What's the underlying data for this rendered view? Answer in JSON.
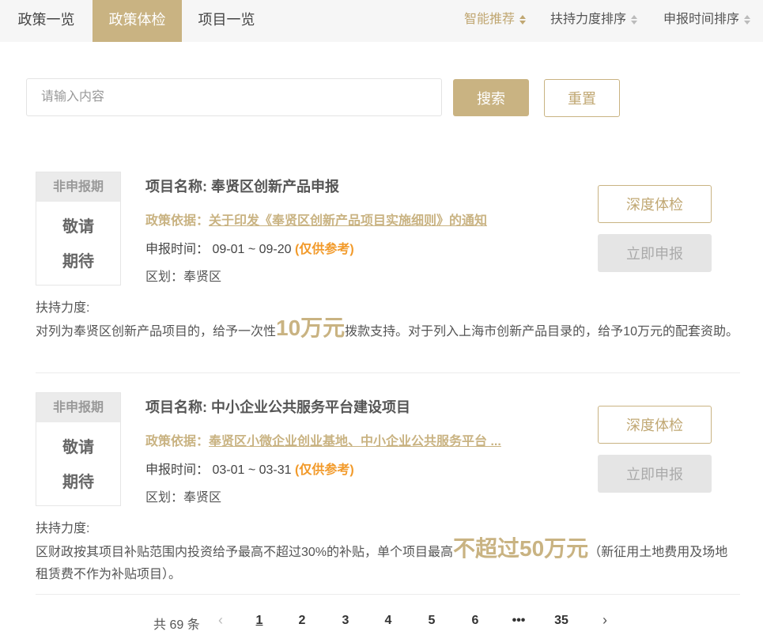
{
  "nav": {
    "tabs": [
      {
        "label": "政策一览"
      },
      {
        "label": "政策体检"
      },
      {
        "label": "项目一览"
      }
    ],
    "sorts": [
      {
        "label": "智能推荐"
      },
      {
        "label": "扶持力度排序"
      },
      {
        "label": "申报时间排序"
      }
    ]
  },
  "search": {
    "placeholder": "请输入内容",
    "value": "",
    "search_label": "搜索",
    "reset_label": "重置"
  },
  "projects": [
    {
      "status": "非申报期",
      "status_body_1": "敬请",
      "status_body_2": "期待",
      "title": "项目名称: 奉贤区创新产品申报",
      "policy_prefix": "政策依据：",
      "policy_link": "关于印发《奉贤区创新产品项目实施细则》的通知",
      "time_prefix": "申报时间：",
      "time_range": "09-01 ~ 09-20",
      "time_note": "(仅供参考)",
      "region": "区划：奉贤区",
      "support_label": "扶持力度:",
      "support_pre": "对列为奉贤区创新产品项目的，给予一次性",
      "support_big": "10万元",
      "support_post": "拨款支持。对于列入上海市创新产品目录的，给予10万元的配套资助。",
      "deep_label": "深度体检",
      "apply_label": "立即申报"
    },
    {
      "status": "非申报期",
      "status_body_1": "敬请",
      "status_body_2": "期待",
      "title": "项目名称: 中小企业公共服务平台建设项目",
      "policy_prefix": "政策依据：",
      "policy_link": "奉贤区小微企业创业基地、中小企业公共服务平台 ...",
      "time_prefix": "申报时间：",
      "time_range": "03-01 ~ 03-31",
      "time_note": "(仅供参考)",
      "region": "区划：奉贤区",
      "support_label": "扶持力度:",
      "support_pre": "区财政按其项目补贴范围内投资给予最高不超过30%的补贴，单个项目最高",
      "support_big": "不超过50万元",
      "support_post": "（新征用土地费用及场地租赁费不作为补贴项目）。",
      "deep_label": "深度体检",
      "apply_label": "立即申报"
    }
  ],
  "pager": {
    "total": "共 69 条",
    "prev": "‹",
    "next": "›",
    "pages": [
      "1",
      "2",
      "3",
      "4",
      "5",
      "6",
      "•••",
      "35"
    ]
  },
  "colors": {
    "accent": "#c9b382",
    "note": "#f29a2a"
  }
}
